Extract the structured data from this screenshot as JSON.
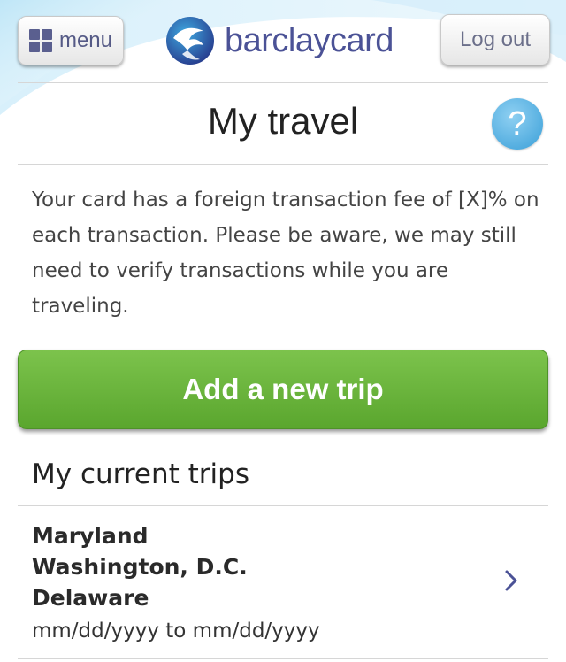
{
  "header": {
    "menu_label": "menu",
    "logo_text": "barclaycard",
    "logout_label": "Log out",
    "icons": {
      "menu": "grid-icon",
      "logo": "eagle-logo-icon"
    }
  },
  "page": {
    "title": "My travel",
    "help_label": "?",
    "help_icon": "question-icon"
  },
  "notice": {
    "text": "Your card has a foreign transaction fee of [X]% on each transaction. Please be aware, we may still need to verify transactions while you are traveling."
  },
  "actions": {
    "add_trip_label": "Add a new trip"
  },
  "trips": {
    "section_title": "My current trips",
    "items": [
      {
        "places": [
          "Maryland",
          "Washington, D.C.",
          "Delaware"
        ],
        "dates": "mm/dd/yyyy to mm/dd/yyyy",
        "icon": "chevron-right-icon"
      }
    ]
  },
  "colors": {
    "brand": "#4b5296",
    "accent_green": "#6ab63c",
    "help_blue": "#4aa8dd",
    "text_dark": "#222222"
  }
}
